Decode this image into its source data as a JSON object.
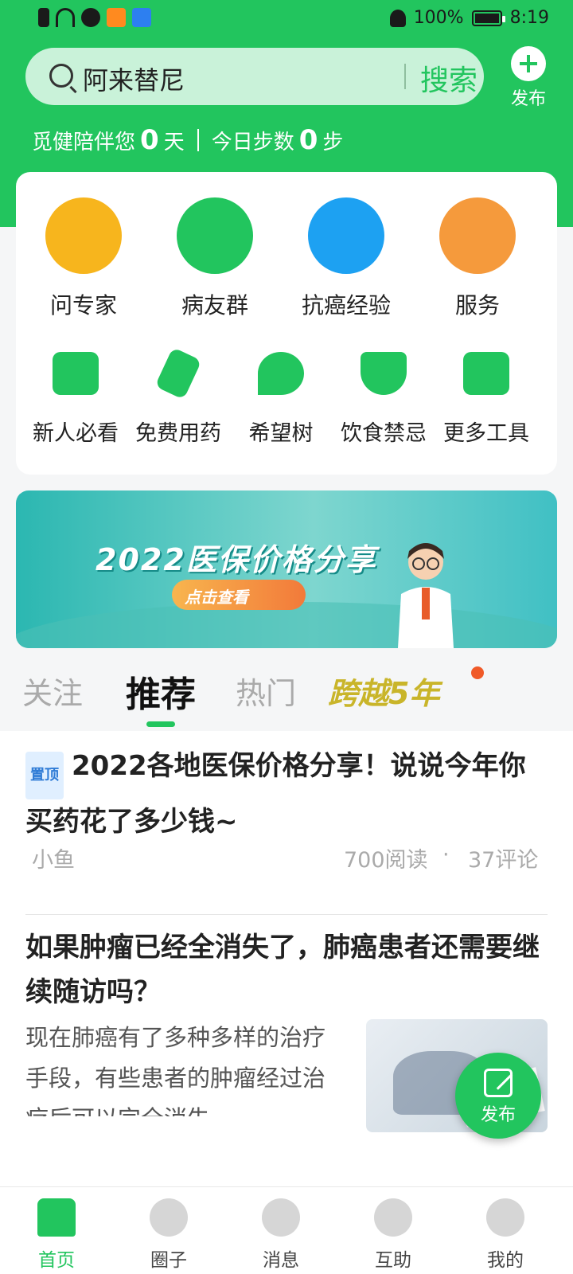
{
  "status_bar": {
    "battery": "100%",
    "time": "8:19"
  },
  "search": {
    "query": "阿来替尼",
    "button": "搜索"
  },
  "publish_top": {
    "label": "发布"
  },
  "streak": {
    "prefix": "觅健陪伴您",
    "days": "0",
    "days_unit": "天",
    "steps_prefix": "今日步数",
    "steps": "0",
    "steps_unit": "步"
  },
  "quick_actions": [
    {
      "label": "问专家",
      "icon": "doctor-icon",
      "color": "#f7b51d"
    },
    {
      "label": "病友群",
      "icon": "chat-bubble-icon",
      "color": "#22c55e"
    },
    {
      "label": "抗癌经验",
      "icon": "pencil-icon",
      "color": "#1da1f2"
    },
    {
      "label": "服务",
      "icon": "shield-star-icon",
      "color": "#f59a3c"
    }
  ],
  "tools": [
    {
      "label": "新人必看",
      "icon": "folder-icon"
    },
    {
      "label": "免费用药",
      "icon": "medicine-bottle-icon"
    },
    {
      "label": "希望树",
      "icon": "sprout-icon"
    },
    {
      "label": "饮食禁忌",
      "icon": "bowl-icon"
    },
    {
      "label": "更多工具",
      "icon": "toolbox-icon"
    }
  ],
  "banner": {
    "title": "2022医保价格分享",
    "cta": "点击查看"
  },
  "tabs": [
    "关注",
    "推荐",
    "热门",
    "跨越5年"
  ],
  "active_tab": "推荐",
  "posts": [
    {
      "pinned_label": "置顶",
      "title": "2022各地医保价格分享！说说今年你买药花了多少钱~",
      "author": "小鱼",
      "reads": "700阅读",
      "comments": "37评论"
    },
    {
      "title": "如果肿瘤已经全消失了，肺癌患者还需要继续随访吗？",
      "excerpt": "现在肺癌有了多种多样的治疗手段，有些患者的肿瘤经过治疗后可以完全消失"
    }
  ],
  "fab": {
    "label": "发布"
  },
  "bottom_nav": [
    "首页",
    "圈子",
    "消息",
    "互助",
    "我的"
  ],
  "active_nav": "首页"
}
